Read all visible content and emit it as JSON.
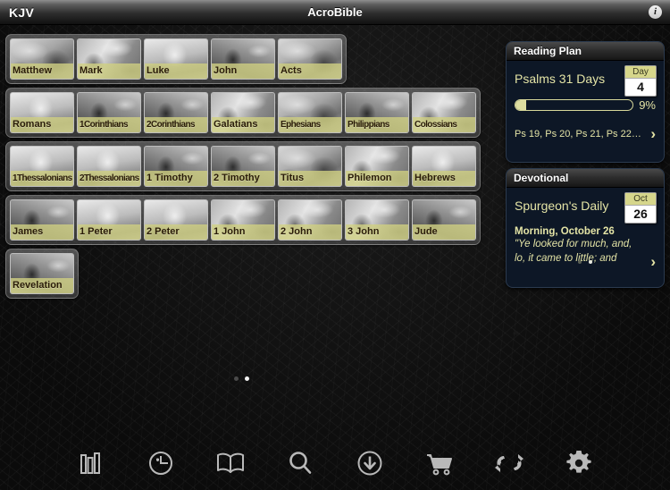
{
  "topbar": {
    "translation": "KJV",
    "title": "AcroBible",
    "info_icon": "info-icon",
    "info_glyph": "i"
  },
  "shelves": [
    {
      "row": 1,
      "books": [
        {
          "label": "Matthew"
        },
        {
          "label": "Mark"
        },
        {
          "label": "Luke"
        },
        {
          "label": "John"
        },
        {
          "label": "Acts"
        }
      ]
    },
    {
      "row": 2,
      "books": [
        {
          "label": "Romans"
        },
        {
          "label": "1Corinthians"
        },
        {
          "label": "2Corinthians"
        },
        {
          "label": "Galatians"
        },
        {
          "label": "Ephesians"
        },
        {
          "label": "Philippians"
        },
        {
          "label": "Colossians"
        }
      ]
    },
    {
      "row": 3,
      "books": [
        {
          "label": "1Thessalonians"
        },
        {
          "label": "2Thessalonians"
        },
        {
          "label": "1 Timothy"
        },
        {
          "label": "2 Timothy"
        },
        {
          "label": "Titus"
        },
        {
          "label": "Philemon"
        },
        {
          "label": "Hebrews"
        }
      ]
    },
    {
      "row": 4,
      "books": [
        {
          "label": "James"
        },
        {
          "label": "1 Peter"
        },
        {
          "label": "2 Peter"
        },
        {
          "label": "1 John"
        },
        {
          "label": "2 John"
        },
        {
          "label": "3 John"
        },
        {
          "label": "Jude"
        }
      ]
    },
    {
      "row": 5,
      "books": [
        {
          "label": "Revelation"
        }
      ]
    }
  ],
  "pager": {
    "total": 2,
    "active_index": 1
  },
  "reading_plan": {
    "header": "Reading Plan",
    "plan_name": "Psalms 31 Days",
    "badge_top": "Day",
    "badge_value": "4",
    "progress_percent": 9,
    "progress_label": "9%",
    "references": "Ps 19, Ps 20, Ps 21, Ps 22…",
    "chevron_icon": "chevron-right-icon",
    "chevron_glyph": "›"
  },
  "devotional": {
    "header": "Devotional",
    "source_name": "Spurgeon's Daily",
    "badge_top": "Oct",
    "badge_value": "26",
    "entry_title": "Morning, October 26",
    "entry_excerpt_line1": "\"Ye looked for much, and,",
    "entry_excerpt_line2": "lo, it came to little; and",
    "chevron_icon": "chevron-right-icon",
    "chevron_glyph": "›",
    "dots_total": 2,
    "dots_active_index": 1
  },
  "toolbar": {
    "items": [
      {
        "icon": "bookshelf-icon",
        "name": "library"
      },
      {
        "icon": "clock-history-icon",
        "name": "history"
      },
      {
        "icon": "open-book-icon",
        "name": "read"
      },
      {
        "icon": "search-icon",
        "name": "search"
      },
      {
        "icon": "download-circle-icon",
        "name": "downloads"
      },
      {
        "icon": "shopping-cart-icon",
        "name": "store"
      },
      {
        "icon": "sync-arrows-icon",
        "name": "sync"
      },
      {
        "icon": "gear-icon",
        "name": "settings"
      }
    ]
  },
  "colors": {
    "accent_yellow": "#e4e4a6",
    "tile_label_bg": "#cfcf82",
    "panel_bg": "#0d1726",
    "toolbar_icon": "#bdbdbd"
  }
}
